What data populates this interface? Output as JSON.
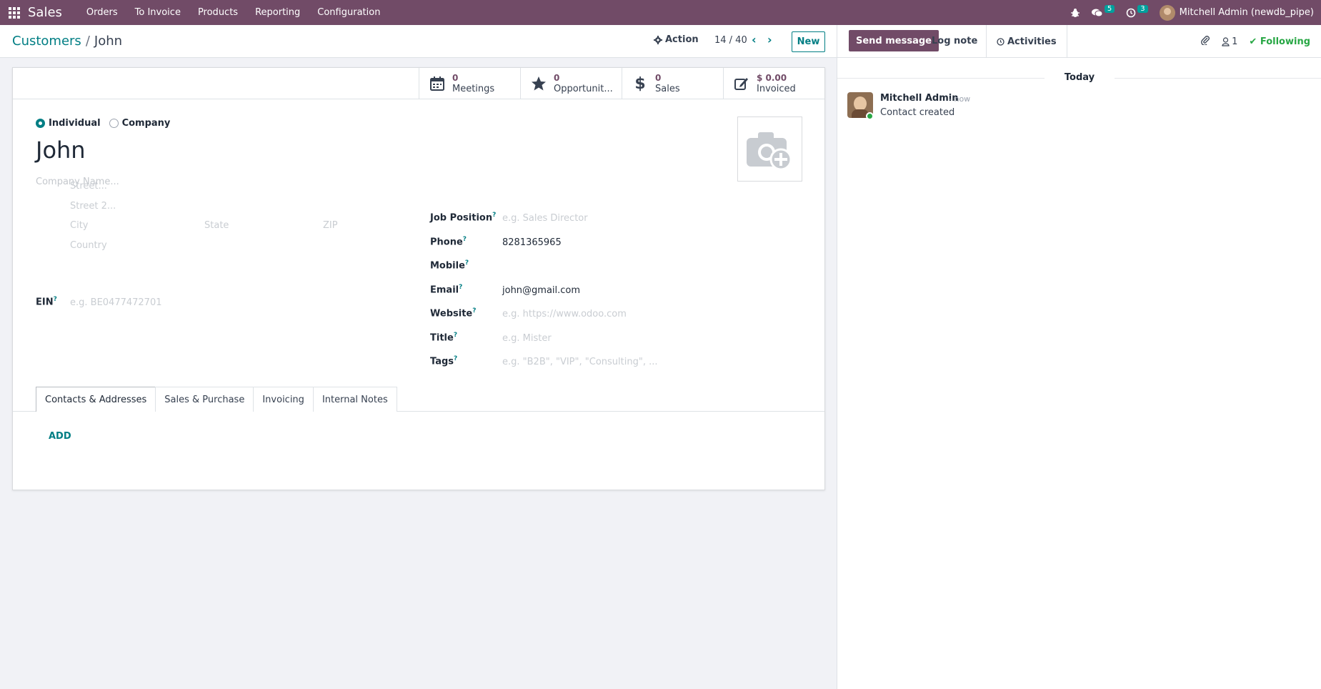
{
  "navbar": {
    "app_name": "Sales",
    "menu": [
      "Orders",
      "To Invoice",
      "Products",
      "Reporting",
      "Configuration"
    ],
    "messages_count": "5",
    "activities_count": "3",
    "user_label": "Mitchell Admin (newdb_pipe)"
  },
  "control": {
    "breadcrumb_parent": "Customers",
    "breadcrumb_sep": "/",
    "breadcrumb_current": "John",
    "action_label": "Action",
    "pager": "14 / 40",
    "new_label": "New"
  },
  "stats": [
    {
      "value": "0",
      "label": "Meetings",
      "icon": "calendar-icon"
    },
    {
      "value": "0",
      "label": "Opportunit...",
      "icon": "star-icon"
    },
    {
      "value": "0",
      "label": "Sales",
      "icon": "dollar-icon"
    },
    {
      "value": "$ 0.00",
      "label": "Invoiced",
      "icon": "edit-icon"
    }
  ],
  "form": {
    "type_individual": "Individual",
    "type_company": "Company",
    "name": "John",
    "company_placeholder": "Company Name...",
    "street_placeholder": "Street...",
    "street2_placeholder": "Street 2...",
    "city_placeholder": "City",
    "state_placeholder": "State",
    "zip_placeholder": "ZIP",
    "country_placeholder": "Country",
    "ein_label": "EIN",
    "ein_placeholder": "e.g. BE0477472701",
    "job_position_label": "Job Position",
    "job_position_placeholder": "e.g. Sales Director",
    "phone_label": "Phone",
    "phone_value": "8281365965",
    "mobile_label": "Mobile",
    "email_label": "Email",
    "email_value": "john@gmail.com",
    "website_label": "Website",
    "website_placeholder": "e.g. https://www.odoo.com",
    "title_label": "Title",
    "title_placeholder": "e.g. Mister",
    "tags_label": "Tags",
    "tags_placeholder": "e.g. \"B2B\", \"VIP\", \"Consulting\", ...",
    "help_mark": "?"
  },
  "tabs": [
    "Contacts & Addresses",
    "Sales & Purchase",
    "Invoicing",
    "Internal Notes"
  ],
  "add_label": "ADD",
  "chatter": {
    "send_message": "Send message",
    "log_note": "Log note",
    "activities": "Activities",
    "followers_count": "1",
    "following": "Following",
    "date_separator": "Today",
    "author": "Mitchell Admin",
    "time": "- now",
    "body": "Contact created"
  },
  "colors": {
    "brand": "#714b67",
    "accent": "#017e84",
    "success": "#28a745"
  }
}
